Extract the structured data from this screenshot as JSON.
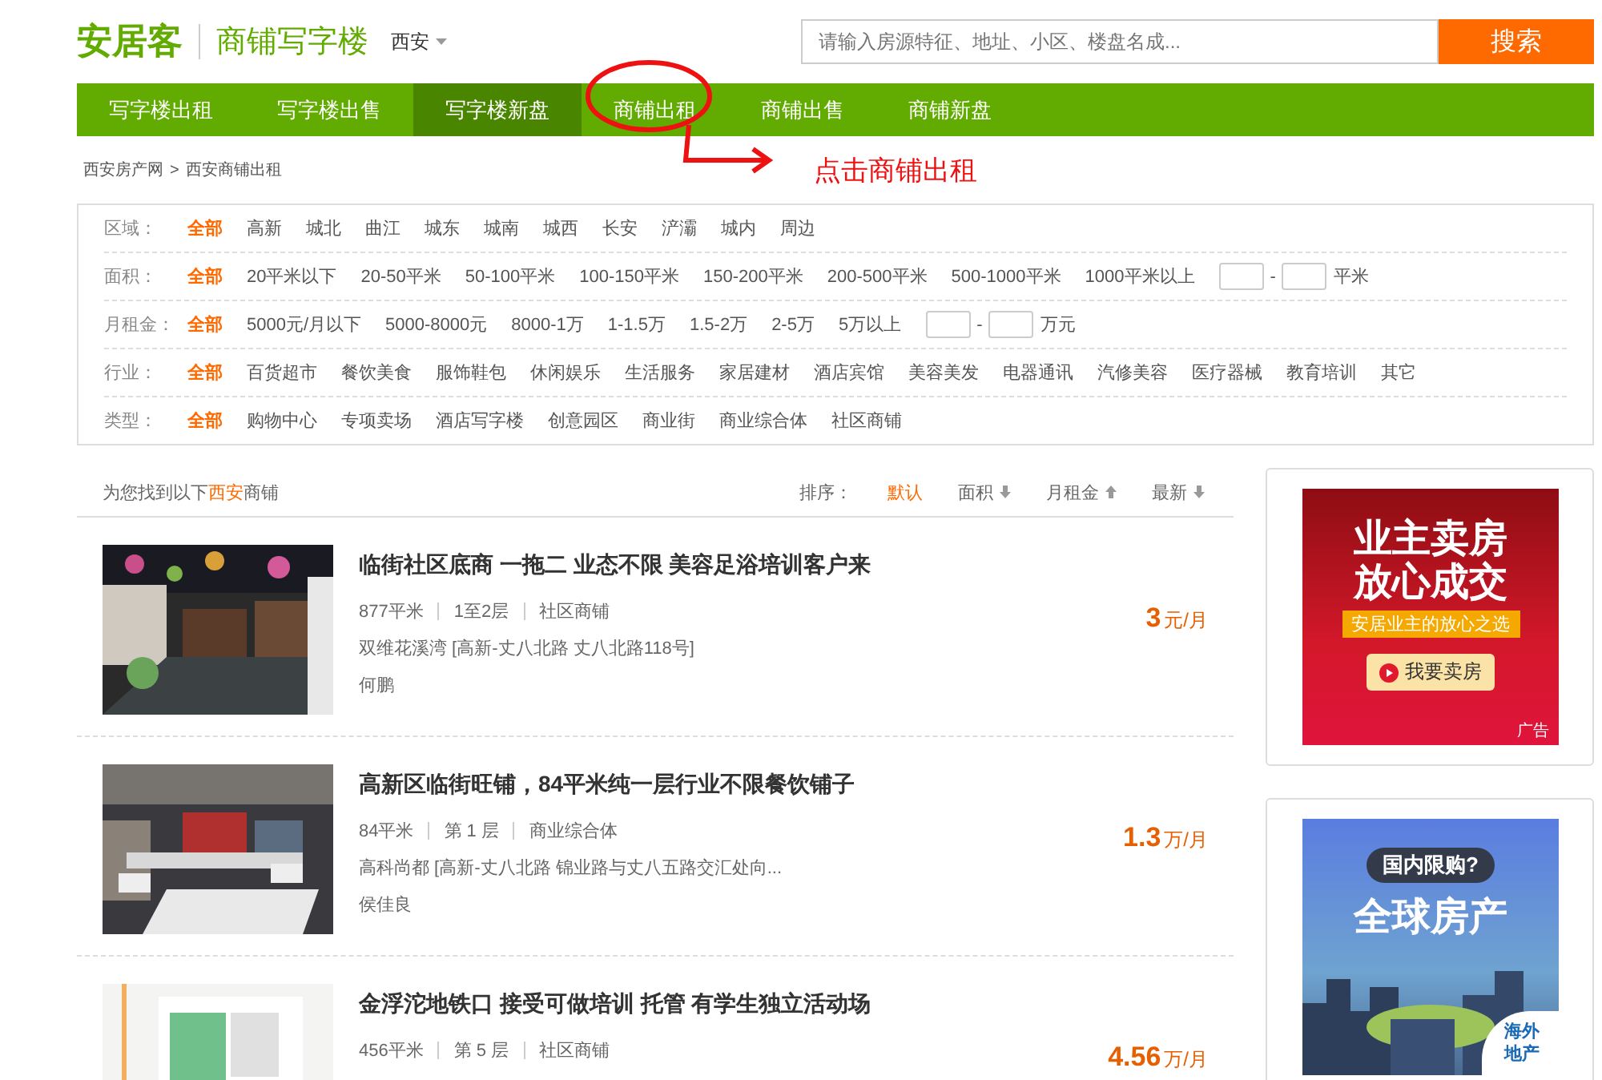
{
  "header": {
    "logo": "安居客",
    "site_name": "商铺写字楼",
    "city": "西安",
    "search": {
      "placeholder": "请输入房源特征、地址、小区、楼盘名成...",
      "button": "搜索"
    }
  },
  "nav": [
    {
      "label": "写字楼出租",
      "selected": false
    },
    {
      "label": "写字楼出售",
      "selected": false
    },
    {
      "label": "写字楼新盘",
      "selected": true
    },
    {
      "label": "商铺出租",
      "selected": false
    },
    {
      "label": "商铺出售",
      "selected": false
    },
    {
      "label": "商铺新盘",
      "selected": false
    }
  ],
  "annotation": {
    "text": "点击商铺出租"
  },
  "breadcrumb": [
    "西安房产网",
    ">",
    "西安商铺出租"
  ],
  "filters": [
    {
      "label": "区域：",
      "options": [
        {
          "label": "全部",
          "selected": true
        },
        {
          "label": "高新",
          "selected": false
        },
        {
          "label": "城北",
          "selected": false
        },
        {
          "label": "曲江",
          "selected": false
        },
        {
          "label": "城东",
          "selected": false
        },
        {
          "label": "城南",
          "selected": false
        },
        {
          "label": "城西",
          "selected": false
        },
        {
          "label": "长安",
          "selected": false
        },
        {
          "label": "浐灞",
          "selected": false
        },
        {
          "label": "城内",
          "selected": false
        },
        {
          "label": "周边",
          "selected": false
        }
      ]
    },
    {
      "label": "面积：",
      "options": [
        {
          "label": "全部",
          "selected": true
        },
        {
          "label": "20平米以下",
          "selected": false
        },
        {
          "label": "20-50平米",
          "selected": false
        },
        {
          "label": "50-100平米",
          "selected": false
        },
        {
          "label": "100-150平米",
          "selected": false
        },
        {
          "label": "150-200平米",
          "selected": false
        },
        {
          "label": "200-500平米",
          "selected": false
        },
        {
          "label": "500-1000平米",
          "selected": false
        },
        {
          "label": "1000平米以上",
          "selected": false
        }
      ],
      "range": {
        "separator": "-",
        "unit": "平米"
      }
    },
    {
      "label": "月租金：",
      "options": [
        {
          "label": "全部",
          "selected": true
        },
        {
          "label": "5000元/月以下",
          "selected": false
        },
        {
          "label": "5000-8000元",
          "selected": false
        },
        {
          "label": "8000-1万",
          "selected": false
        },
        {
          "label": "1-1.5万",
          "selected": false
        },
        {
          "label": "1.5-2万",
          "selected": false
        },
        {
          "label": "2-5万",
          "selected": false
        },
        {
          "label": "5万以上",
          "selected": false
        }
      ],
      "range": {
        "separator": "-",
        "unit": "万元"
      }
    },
    {
      "label": "行业：",
      "options": [
        {
          "label": "全部",
          "selected": true
        },
        {
          "label": "百货超市",
          "selected": false
        },
        {
          "label": "餐饮美食",
          "selected": false
        },
        {
          "label": "服饰鞋包",
          "selected": false
        },
        {
          "label": "休闲娱乐",
          "selected": false
        },
        {
          "label": "生活服务",
          "selected": false
        },
        {
          "label": "家居建材",
          "selected": false
        },
        {
          "label": "酒店宾馆",
          "selected": false
        },
        {
          "label": "美容美发",
          "selected": false
        },
        {
          "label": "电器通讯",
          "selected": false
        },
        {
          "label": "汽修美容",
          "selected": false
        },
        {
          "label": "医疗器械",
          "selected": false
        },
        {
          "label": "教育培训",
          "selected": false
        },
        {
          "label": "其它",
          "selected": false
        }
      ]
    },
    {
      "label": "类型：",
      "options": [
        {
          "label": "全部",
          "selected": true
        },
        {
          "label": "购物中心",
          "selected": false
        },
        {
          "label": "专项卖场",
          "selected": false
        },
        {
          "label": "酒店写字楼",
          "selected": false
        },
        {
          "label": "创意园区",
          "selected": false
        },
        {
          "label": "商业街",
          "selected": false
        },
        {
          "label": "商业综合体",
          "selected": false
        },
        {
          "label": "社区商铺",
          "selected": false
        }
      ]
    }
  ],
  "results": {
    "prefix": "为您找到以下",
    "city": "西安",
    "suffix": "商铺",
    "sort_label": "排序：",
    "sort": [
      {
        "label": "默认",
        "selected": true
      },
      {
        "label": "面积",
        "ascending": false,
        "selected": false
      },
      {
        "label": "月租金",
        "ascending": true,
        "selected": false
      },
      {
        "label": "最新",
        "ascending": false,
        "selected": false
      }
    ]
  },
  "listings": [
    {
      "kind": "picture",
      "title": "临街社区底商 一拖二 业态不限 美容足浴培训客户来",
      "meta": [
        "877平米",
        "1至2层",
        "社区商铺"
      ],
      "address": "双维花溪湾 [高新-丈八北路 丈八北路118号]",
      "agent": "何鹏",
      "price": "3",
      "unit": "元/月"
    },
    {
      "kind": "picture",
      "title": "高新区临街旺铺，84平米纯一层行业不限餐饮铺子",
      "meta": [
        "84平米",
        "第 1 层",
        "商业综合体"
      ],
      "address": "高科尚都 [高新-丈八北路 锦业路与丈八五路交汇处向...",
      "agent": "侯佳良",
      "price": "1.3",
      "unit": "万/月"
    },
    {
      "kind": "picture",
      "title": "金浮沱地铁口 接受可做培训 托管 有学生独立活动场",
      "meta": [
        "456平米",
        "第 5 层",
        "社区商铺"
      ],
      "price": "4.56",
      "unit": "万/月"
    }
  ],
  "ads": [
    {
      "kind": "red",
      "lines": [
        "业主卖房",
        "放心成交"
      ],
      "tagline": "安居业主的放心之选",
      "button": "我要卖房",
      "label": "广告"
    },
    {
      "kind": "blue",
      "question": "国内限购?",
      "lines": [
        "全球房产"
      ],
      "corner": "海外地产"
    }
  ]
}
